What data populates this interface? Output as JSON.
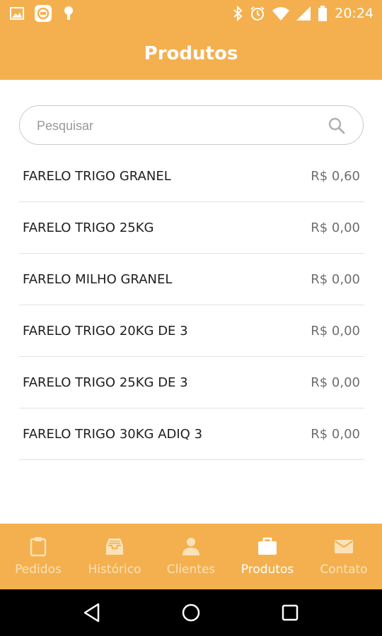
{
  "status_bar": {
    "time": "20:24",
    "left_icons": [
      "image-icon",
      "app-notification-icon",
      "android-icon"
    ],
    "right_icons": [
      "bluetooth-icon",
      "alarm-icon",
      "wifi-icon",
      "signal-icon",
      "battery-icon"
    ]
  },
  "header": {
    "title": "Produtos"
  },
  "search": {
    "placeholder": "Pesquisar",
    "value": ""
  },
  "products": [
    {
      "name": "FARELO TRIGO GRANEL",
      "price": "R$ 0,60"
    },
    {
      "name": "FARELO TRIGO 25KG",
      "price": "R$ 0,00"
    },
    {
      "name": "FARELO MILHO GRANEL",
      "price": "R$ 0,00"
    },
    {
      "name": "FARELO TRIGO 20KG DE 3",
      "price": "R$ 0,00"
    },
    {
      "name": "FARELO TRIGO 25KG DE 3",
      "price": "R$ 0,00"
    },
    {
      "name": "FARELO TRIGO 30KG ADIQ 3",
      "price": "R$ 0,00"
    }
  ],
  "bottom_nav": {
    "items": [
      {
        "label": "Pedidos",
        "icon": "clipboard-icon",
        "active": false
      },
      {
        "label": "Histórico",
        "icon": "inbox-icon",
        "active": false
      },
      {
        "label": "Clientes",
        "icon": "person-icon",
        "active": false
      },
      {
        "label": "Produtos",
        "icon": "briefcase-icon",
        "active": true
      },
      {
        "label": "Contato",
        "icon": "envelope-icon",
        "active": false
      }
    ]
  },
  "colors": {
    "primary": "#f4b04f",
    "nav_inactive": "#fbe2b8",
    "nav_active": "#ffffff"
  }
}
